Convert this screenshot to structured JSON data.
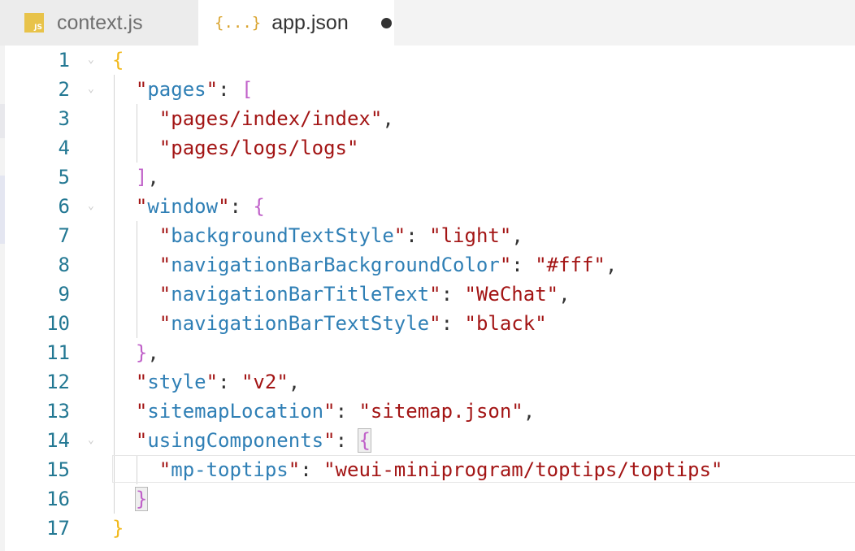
{
  "tabs": [
    {
      "icon": "js-file-icon",
      "icon_text": "JS",
      "label": "context.js",
      "active": false
    },
    {
      "icon": "json-file-icon",
      "icon_text": "{...}",
      "label": "app.json",
      "active": true,
      "unsaved": true
    }
  ],
  "editor": {
    "cursor_line": 15,
    "fold_marker": "⌄",
    "lines": [
      {
        "n": "1",
        "fold": true,
        "tokens": [
          [
            "t-brace",
            "{"
          ]
        ]
      },
      {
        "n": "2",
        "fold": true,
        "tokens": [
          [
            "t-punc",
            "  "
          ],
          [
            "t-quote",
            "\""
          ],
          [
            "t-key",
            "pages"
          ],
          [
            "t-quote",
            "\""
          ],
          [
            "t-punc",
            ": "
          ],
          [
            "t-bracket",
            "["
          ]
        ]
      },
      {
        "n": "3",
        "fold": false,
        "tokens": [
          [
            "t-punc",
            "    "
          ],
          [
            "t-str",
            "\"pages/index/index\""
          ],
          [
            "t-punc",
            ","
          ]
        ]
      },
      {
        "n": "4",
        "fold": false,
        "tokens": [
          [
            "t-punc",
            "    "
          ],
          [
            "t-str",
            "\"pages/logs/logs\""
          ]
        ]
      },
      {
        "n": "5",
        "fold": false,
        "tokens": [
          [
            "t-punc",
            "  "
          ],
          [
            "t-bracket",
            "]"
          ],
          [
            "t-punc",
            ","
          ]
        ]
      },
      {
        "n": "6",
        "fold": true,
        "tokens": [
          [
            "t-punc",
            "  "
          ],
          [
            "t-quote",
            "\""
          ],
          [
            "t-key",
            "window"
          ],
          [
            "t-quote",
            "\""
          ],
          [
            "t-punc",
            ": "
          ],
          [
            "t-bracket",
            "{"
          ]
        ]
      },
      {
        "n": "7",
        "fold": false,
        "tokens": [
          [
            "t-punc",
            "    "
          ],
          [
            "t-quote",
            "\""
          ],
          [
            "t-key",
            "backgroundTextStyle"
          ],
          [
            "t-quote",
            "\""
          ],
          [
            "t-punc",
            ": "
          ],
          [
            "t-str",
            "\"light\""
          ],
          [
            "t-punc",
            ","
          ]
        ]
      },
      {
        "n": "8",
        "fold": false,
        "tokens": [
          [
            "t-punc",
            "    "
          ],
          [
            "t-quote",
            "\""
          ],
          [
            "t-key",
            "navigationBarBackgroundColor"
          ],
          [
            "t-quote",
            "\""
          ],
          [
            "t-punc",
            ": "
          ],
          [
            "t-str",
            "\"#fff\""
          ],
          [
            "t-punc",
            ","
          ]
        ]
      },
      {
        "n": "9",
        "fold": false,
        "tokens": [
          [
            "t-punc",
            "    "
          ],
          [
            "t-quote",
            "\""
          ],
          [
            "t-key",
            "navigationBarTitleText"
          ],
          [
            "t-quote",
            "\""
          ],
          [
            "t-punc",
            ": "
          ],
          [
            "t-str",
            "\"WeChat\""
          ],
          [
            "t-punc",
            ","
          ]
        ]
      },
      {
        "n": "10",
        "fold": false,
        "tokens": [
          [
            "t-punc",
            "    "
          ],
          [
            "t-quote",
            "\""
          ],
          [
            "t-key",
            "navigationBarTextStyle"
          ],
          [
            "t-quote",
            "\""
          ],
          [
            "t-punc",
            ": "
          ],
          [
            "t-str",
            "\"black\""
          ]
        ]
      },
      {
        "n": "11",
        "fold": false,
        "tokens": [
          [
            "t-punc",
            "  "
          ],
          [
            "t-bracket",
            "}"
          ],
          [
            "t-punc",
            ","
          ]
        ]
      },
      {
        "n": "12",
        "fold": false,
        "tokens": [
          [
            "t-punc",
            "  "
          ],
          [
            "t-quote",
            "\""
          ],
          [
            "t-key",
            "style"
          ],
          [
            "t-quote",
            "\""
          ],
          [
            "t-punc",
            ": "
          ],
          [
            "t-str",
            "\"v2\""
          ],
          [
            "t-punc",
            ","
          ]
        ]
      },
      {
        "n": "13",
        "fold": false,
        "tokens": [
          [
            "t-punc",
            "  "
          ],
          [
            "t-quote",
            "\""
          ],
          [
            "t-key",
            "sitemapLocation"
          ],
          [
            "t-quote",
            "\""
          ],
          [
            "t-punc",
            ": "
          ],
          [
            "t-str",
            "\"sitemap.json\""
          ],
          [
            "t-punc",
            ","
          ]
        ]
      },
      {
        "n": "14",
        "fold": true,
        "tokens": [
          [
            "t-punc",
            "  "
          ],
          [
            "t-quote",
            "\""
          ],
          [
            "t-key",
            "usingComponents"
          ],
          [
            "t-quote",
            "\""
          ],
          [
            "t-punc",
            ": "
          ],
          [
            "t-bracket match-box",
            "{"
          ]
        ]
      },
      {
        "n": "15",
        "fold": false,
        "tokens": [
          [
            "t-punc",
            "    "
          ],
          [
            "t-quote",
            "\""
          ],
          [
            "t-key",
            "mp-toptips"
          ],
          [
            "t-quote",
            "\""
          ],
          [
            "t-punc",
            ": "
          ],
          [
            "t-str",
            "\"weui-miniprogram/toptips/toptips\""
          ]
        ]
      },
      {
        "n": "16",
        "fold": false,
        "tokens": [
          [
            "t-punc",
            "  "
          ],
          [
            "t-bracket match-box",
            "}"
          ]
        ]
      },
      {
        "n": "17",
        "fold": false,
        "tokens": [
          [
            "t-brace",
            "}"
          ]
        ]
      }
    ]
  }
}
